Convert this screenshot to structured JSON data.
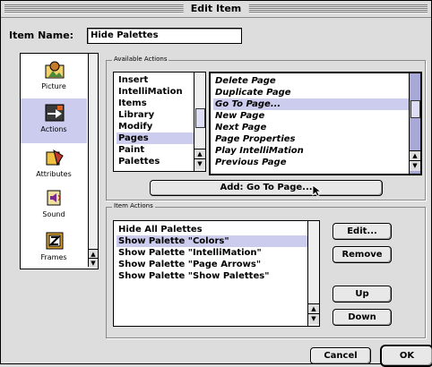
{
  "window": {
    "title": "Edit Item"
  },
  "item_name": {
    "label": "Item Name:",
    "value": "Hide Palettes"
  },
  "sidebar": {
    "items": [
      {
        "label": "Picture",
        "icon": "picture-icon"
      },
      {
        "label": "Actions",
        "icon": "actions-icon",
        "selected": true
      },
      {
        "label": "Attributes",
        "icon": "attributes-icon"
      },
      {
        "label": "Sound",
        "icon": "sound-icon"
      },
      {
        "label": "Frames",
        "icon": "frames-icon"
      }
    ]
  },
  "available_actions": {
    "group_label": "Available Actions",
    "categories": [
      "Insert",
      "IntelliMation",
      "Items",
      "Library",
      "Modify",
      "Pages",
      "Paint",
      "Palettes"
    ],
    "selected_category": "Pages",
    "actions": [
      "Delete Page",
      "Duplicate Page",
      "Go To Page...",
      "New Page",
      "Next Page",
      "Page Properties",
      "Play IntelliMation",
      "Previous Page"
    ],
    "selected_action": "Go To Page...",
    "add_button": "Add:  Go To Page..."
  },
  "item_actions": {
    "group_label": "Item Actions",
    "rows": [
      "Hide All Palettes",
      "Show Palette \"Colors\"",
      "Show Palette \"IntelliMation\"",
      "Show Palette \"Page Arrows\"",
      "Show Palette \"Show Palettes\""
    ],
    "selected_row": "Show Palette \"Colors\"",
    "edit_button": "Edit...",
    "remove_button": "Remove",
    "up_button": "Up",
    "down_button": "Down"
  },
  "footer": {
    "cancel_button": "Cancel",
    "ok_button": "OK"
  }
}
